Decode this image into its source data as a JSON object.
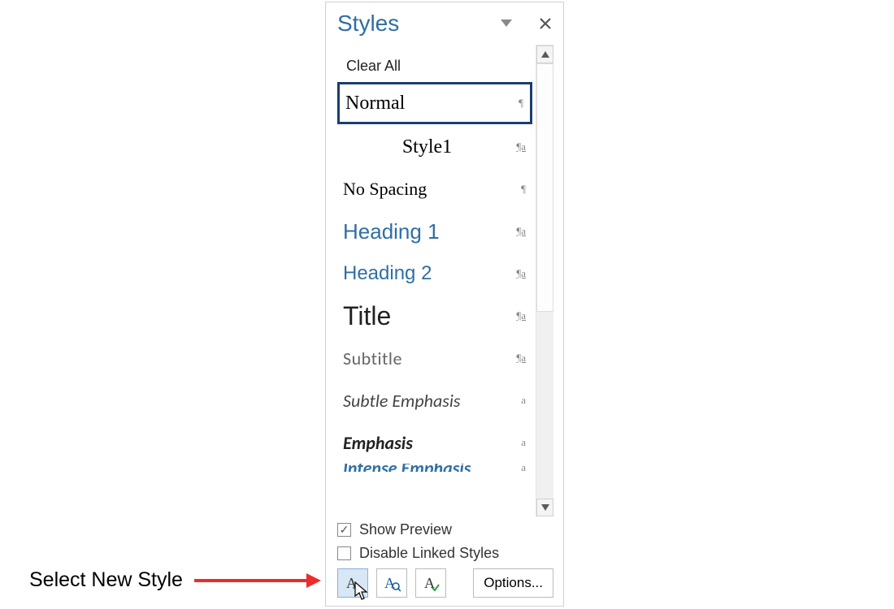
{
  "pane": {
    "title": "Styles",
    "clear_all": "Clear All",
    "items": [
      {
        "label": "Normal",
        "mark": "¶",
        "markClass": "",
        "rowClass": "row-normal"
      },
      {
        "label": "Style1",
        "mark": "¶a",
        "markClass": "underline",
        "rowClass": "row-style1"
      },
      {
        "label": "No Spacing",
        "mark": "¶",
        "markClass": "",
        "rowClass": "row-nospacing"
      },
      {
        "label": "Heading 1",
        "mark": "¶a",
        "markClass": "underline",
        "rowClass": "row-h1"
      },
      {
        "label": "Heading 2",
        "mark": "¶a",
        "markClass": "underline",
        "rowClass": "row-h2"
      },
      {
        "label": "Title",
        "mark": "¶a",
        "markClass": "underline",
        "rowClass": "row-title"
      },
      {
        "label": "Subtitle",
        "mark": "¶a",
        "markClass": "underline",
        "rowClass": "row-subtitle"
      },
      {
        "label": "Subtle Emphasis",
        "mark": "a",
        "markClass": "",
        "rowClass": "row-subtle"
      },
      {
        "label": "Emphasis",
        "mark": "a",
        "markClass": "",
        "rowClass": "row-emph"
      },
      {
        "label": "Intense Emphasis",
        "mark": "a",
        "markClass": "",
        "rowClass": "row-intense"
      }
    ],
    "show_preview": "Show Preview",
    "disable_linked": "Disable Linked Styles",
    "options": "Options..."
  },
  "callout": {
    "text": "Select New Style"
  },
  "colors": {
    "accent": "#2f6fa3",
    "selected_border": "#1a3e6e",
    "arrow": "#ee2b2b"
  }
}
